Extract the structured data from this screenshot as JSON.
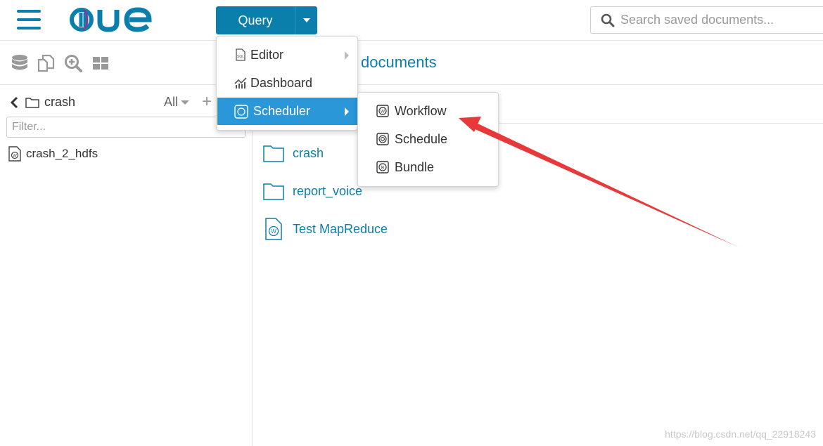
{
  "header": {
    "query_label": "Query",
    "search_placeholder": "Search saved documents..."
  },
  "left_panel": {
    "breadcrumb": "crash",
    "filter_all": "All",
    "filter_placeholder": "Filter...",
    "files": [
      "crash_2_hdfs"
    ]
  },
  "main": {
    "title_partial": "documents",
    "documents": [
      {
        "name": "crash",
        "type": "folder"
      },
      {
        "name": "report_voice",
        "type": "folder"
      },
      {
        "name": "Test MapReduce",
        "type": "workflow"
      }
    ]
  },
  "menu": {
    "items": [
      {
        "label": "Editor",
        "icon": "editor-icon",
        "has_submenu": true
      },
      {
        "label": "Dashboard",
        "icon": "dashboard-icon",
        "has_submenu": false
      },
      {
        "label": "Scheduler",
        "icon": "scheduler-icon",
        "has_submenu": true,
        "active": true
      }
    ]
  },
  "submenu": {
    "items": [
      {
        "label": "Workflow",
        "icon": "workflow-icon"
      },
      {
        "label": "Schedule",
        "icon": "schedule-icon"
      },
      {
        "label": "Bundle",
        "icon": "bundle-icon"
      }
    ]
  },
  "watermark": "https://blog.csdn.net/qq_22918243",
  "colors": {
    "brand": "#0b7fab",
    "menu_active": "#2a97d8",
    "annotation": "#e8393a"
  }
}
